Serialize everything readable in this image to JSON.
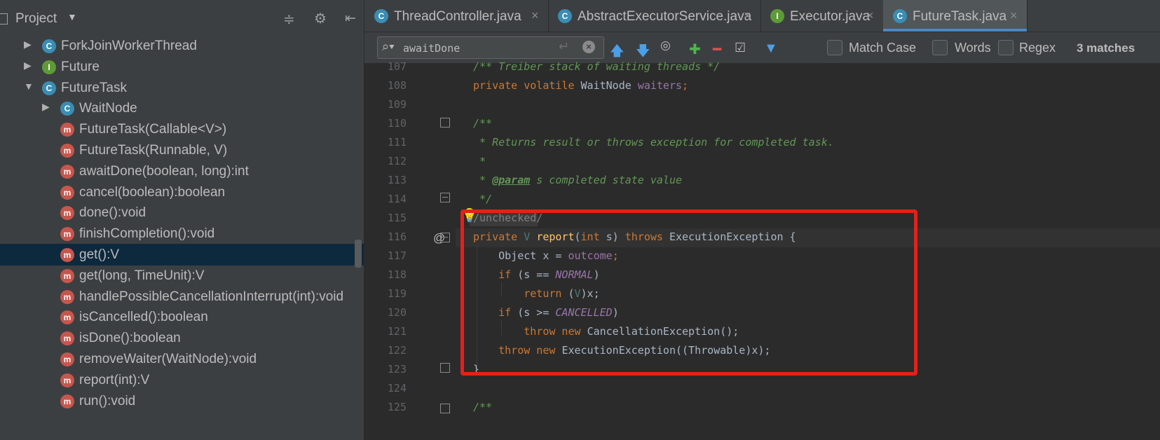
{
  "project_panel": {
    "title": "Project",
    "icons": {
      "collapse": "collapse-all-icon",
      "settings": "gear-icon",
      "hide": "hide-panel-icon"
    },
    "items": [
      {
        "label": "ForkJoinWorkerThread",
        "kind": "class",
        "badge": "C",
        "arrow": "▶"
      },
      {
        "label": "Future",
        "kind": "interface",
        "badge": "I",
        "arrow": "▶"
      },
      {
        "label": "FutureTask",
        "kind": "class",
        "badge": "C",
        "arrow": "▼"
      },
      {
        "label": "WaitNode",
        "kind": "class",
        "badge": "C",
        "arrow": "▶"
      },
      {
        "label": "FutureTask(Callable<V>)",
        "kind": "method",
        "badge": "m",
        "arrow": ""
      },
      {
        "label": "FutureTask(Runnable, V)",
        "kind": "method",
        "badge": "m",
        "arrow": ""
      },
      {
        "label": "awaitDone(boolean, long):int",
        "kind": "method",
        "badge": "m",
        "arrow": ""
      },
      {
        "label": "cancel(boolean):boolean",
        "kind": "method",
        "badge": "m",
        "arrow": ""
      },
      {
        "label": "done():void",
        "kind": "method",
        "badge": "m",
        "arrow": ""
      },
      {
        "label": "finishCompletion():void",
        "kind": "method",
        "badge": "m",
        "arrow": ""
      },
      {
        "label": "get():V",
        "kind": "method",
        "badge": "m",
        "arrow": "",
        "selected": true
      },
      {
        "label": "get(long, TimeUnit):V",
        "kind": "method",
        "badge": "m",
        "arrow": ""
      },
      {
        "label": "handlePossibleCancellationInterrupt(int):void",
        "kind": "method",
        "badge": "m",
        "arrow": ""
      },
      {
        "label": "isCancelled():boolean",
        "kind": "method",
        "badge": "m",
        "arrow": ""
      },
      {
        "label": "isDone():boolean",
        "kind": "method",
        "badge": "m",
        "arrow": ""
      },
      {
        "label": "removeWaiter(WaitNode):void",
        "kind": "method",
        "badge": "m",
        "arrow": ""
      },
      {
        "label": "report(int):V",
        "kind": "method",
        "badge": "m",
        "arrow": ""
      },
      {
        "label": "run():void",
        "kind": "method",
        "badge": "m",
        "arrow": ""
      }
    ]
  },
  "tabs": [
    {
      "label": "ThreadController.java",
      "icon": "C",
      "active": false
    },
    {
      "label": "AbstractExecutorService.java",
      "icon": "C",
      "active": false
    },
    {
      "label": "Executor.java",
      "icon": "I",
      "active": false
    },
    {
      "label": "FutureTask.java",
      "icon": "C",
      "active": true
    }
  ],
  "search": {
    "value": "awaitDone",
    "match_case_label": "Match Case",
    "words_label": "Words",
    "regex_label": "Regex",
    "matches": "3 matches",
    "tool_icons": [
      "previous-occurrence-icon",
      "next-occurrence-icon",
      "find-all-icon",
      "add-selection-icon",
      "remove-selection-icon",
      "select-all-occurrences-icon",
      "filter-icon"
    ]
  },
  "editor": {
    "line_numbers": [
      "107",
      "108",
      "109",
      "110",
      "111",
      "112",
      "113",
      "114",
      "115",
      "116",
      "117",
      "118",
      "119",
      "120",
      "121",
      "122",
      "123",
      "124",
      "125"
    ],
    "lines": {
      "l107": "/** Treiber stack of waiting threads */",
      "l108_kw": "private volatile ",
      "l108_type": "WaitNode ",
      "l108_field": "waiters",
      "l108_end": ";",
      "l110": "/**",
      "l111": " * Returns result or throws exception for completed task.",
      "l112": " *",
      "l113_pre": " * ",
      "l113_tag": "@param",
      "l113_post": " s completed state value",
      "l114": " */",
      "l115": "/unchecked/",
      "l116_kw1": "private ",
      "l116_tp": "V ",
      "l116_meth": "report",
      "l116_mid": "(",
      "l116_kw2": "int",
      "l116_s": " s) ",
      "l116_kw3": "throws ",
      "l116_end": "ExecutionException {",
      "l117_pre": "    Object x = ",
      "l117_field": "outcome",
      "l117_end": ";",
      "l118_kw": "    if ",
      "l118_mid": "(s == ",
      "l118_const": "NORMAL",
      "l118_end": ")",
      "l119_kw": "        return ",
      "l119_mid": "(",
      "l119_tp": "V",
      "l119_end": ")x;",
      "l120_kw": "    if ",
      "l120_mid": "(s >= ",
      "l120_const": "CANCELLED",
      "l120_end": ")",
      "l121_kw": "        throw new ",
      "l121_end": "CancellationException();",
      "l122_kw": "    throw new ",
      "l122_end": "ExecutionException((Throwable)x);",
      "l123": "}",
      "l125": "/**"
    },
    "gutter_marker": "@",
    "intention_icon": "lightbulb-icon"
  },
  "colors": {
    "annotation_box": "#e5201a",
    "selection": "#0d293e",
    "active_tab_underline": "#4a88c7"
  }
}
